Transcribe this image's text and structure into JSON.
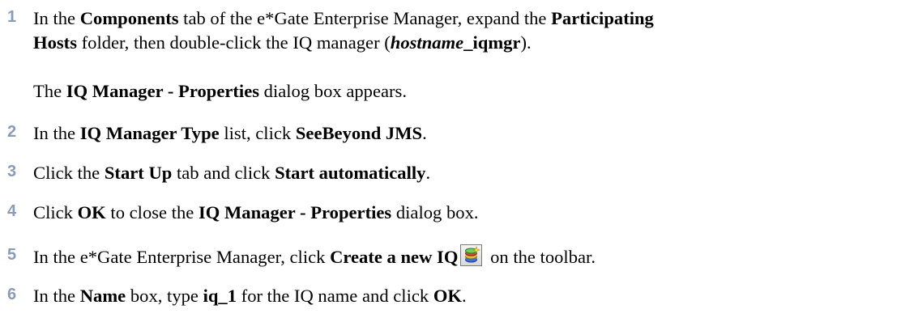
{
  "steps": [
    {
      "number": "1",
      "line1": {
        "t0": "In the ",
        "b0": "Components",
        "t1": " tab of the e*Gate Enterprise Manager, expand the ",
        "b1": "Participating"
      },
      "line2": {
        "b0": "Hosts",
        "t0": " folder, then double-click the IQ manager (",
        "i0": "hostname",
        "b1": "_iqmgr",
        "t1": ")."
      },
      "note": {
        "t0": "The ",
        "b0": "IQ Manager - Properties",
        "t1": " dialog box appears."
      }
    },
    {
      "number": "2",
      "t0": "In the ",
      "b0": "IQ Manager Type",
      "t1": " list, click ",
      "b1": "SeeBeyond JMS",
      "t2": "."
    },
    {
      "number": "3",
      "t0": "Click the ",
      "b0": "Start Up",
      "t1": " tab and click ",
      "b1": "Start automatically",
      "t2": "."
    },
    {
      "number": "4",
      "t0": "Click ",
      "b0": "OK",
      "t1": " to close the ",
      "b1": "IQ Manager - Properties",
      "t2": " dialog box."
    },
    {
      "number": "5",
      "t0": "In the e*Gate Enterprise Manager, click ",
      "b0": "Create a new IQ",
      "icon": "create-new-iq-icon",
      "t1": " on the toolbar."
    },
    {
      "number": "6",
      "t0": "In the ",
      "b0": "Name",
      "t1": " box, type ",
      "b1": "iq_1",
      "t2": " for the IQ name and click ",
      "b2": "OK",
      "t3": "."
    }
  ],
  "colors": {
    "step_number": "#8a9bb5",
    "text": "#000000"
  }
}
